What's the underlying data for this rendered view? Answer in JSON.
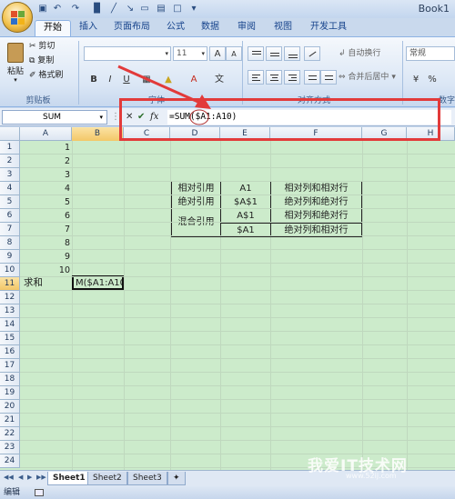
{
  "window": {
    "title": "Book1"
  },
  "ribbon": {
    "tabs": [
      "开始",
      "插入",
      "页面布局",
      "公式",
      "数据",
      "审阅",
      "视图",
      "开发工具"
    ],
    "active_tab": "开始",
    "clipboard": {
      "paste": "粘贴",
      "cut": "剪切",
      "copy": "复制",
      "format_painter": "格式刷",
      "label": "剪贴板"
    },
    "font": {
      "size": "11",
      "bold": "B",
      "italic": "I",
      "underline": "U",
      "label": "字体",
      "phonetic": "文"
    },
    "alignment": {
      "wrap_text": "自动换行",
      "merge_center": "合并后居中",
      "label": "对齐方式"
    },
    "number": {
      "format": "常规",
      "label": "数字"
    }
  },
  "formula_bar": {
    "name_box": "SUM",
    "formula": "=SUM($A1:A10)",
    "fx": "fx"
  },
  "grid": {
    "columns": [
      "A",
      "B",
      "C",
      "D",
      "E",
      "F",
      "G",
      "H"
    ],
    "rows": [
      "1",
      "2",
      "3",
      "4",
      "5",
      "6",
      "7",
      "8",
      "9",
      "10",
      "11",
      "12",
      "13",
      "14",
      "15",
      "16",
      "17",
      "18",
      "19",
      "20",
      "21",
      "22",
      "23",
      "24"
    ],
    "selected_column": "B",
    "selected_row": "11",
    "column_a_values": [
      "1",
      "2",
      "3",
      "4",
      "5",
      "6",
      "7",
      "8",
      "9",
      "10"
    ],
    "a11": "求和",
    "b11": "M($A1:A10",
    "ref_table": {
      "rows": [
        [
          "相对引用",
          "A1",
          "相对列和相对行"
        ],
        [
          "绝对引用",
          "$A$1",
          "绝对列和绝对行"
        ],
        [
          "混合引用",
          "A$1",
          "相对列和绝对行"
        ],
        [
          "",
          "$A1",
          "绝对列和相对行"
        ]
      ]
    }
  },
  "sheets": [
    "Sheet1",
    "Sheet2",
    "Sheet3"
  ],
  "active_sheet": "Sheet1",
  "status": {
    "mode": "编辑"
  },
  "watermark": {
    "text": "我爱IT技术网",
    "url": "www.52ij.com"
  },
  "colors": {
    "highlight": "#e23a3a",
    "grid_bg": "#ccebcb",
    "ribbon_accent": "#15428b"
  }
}
